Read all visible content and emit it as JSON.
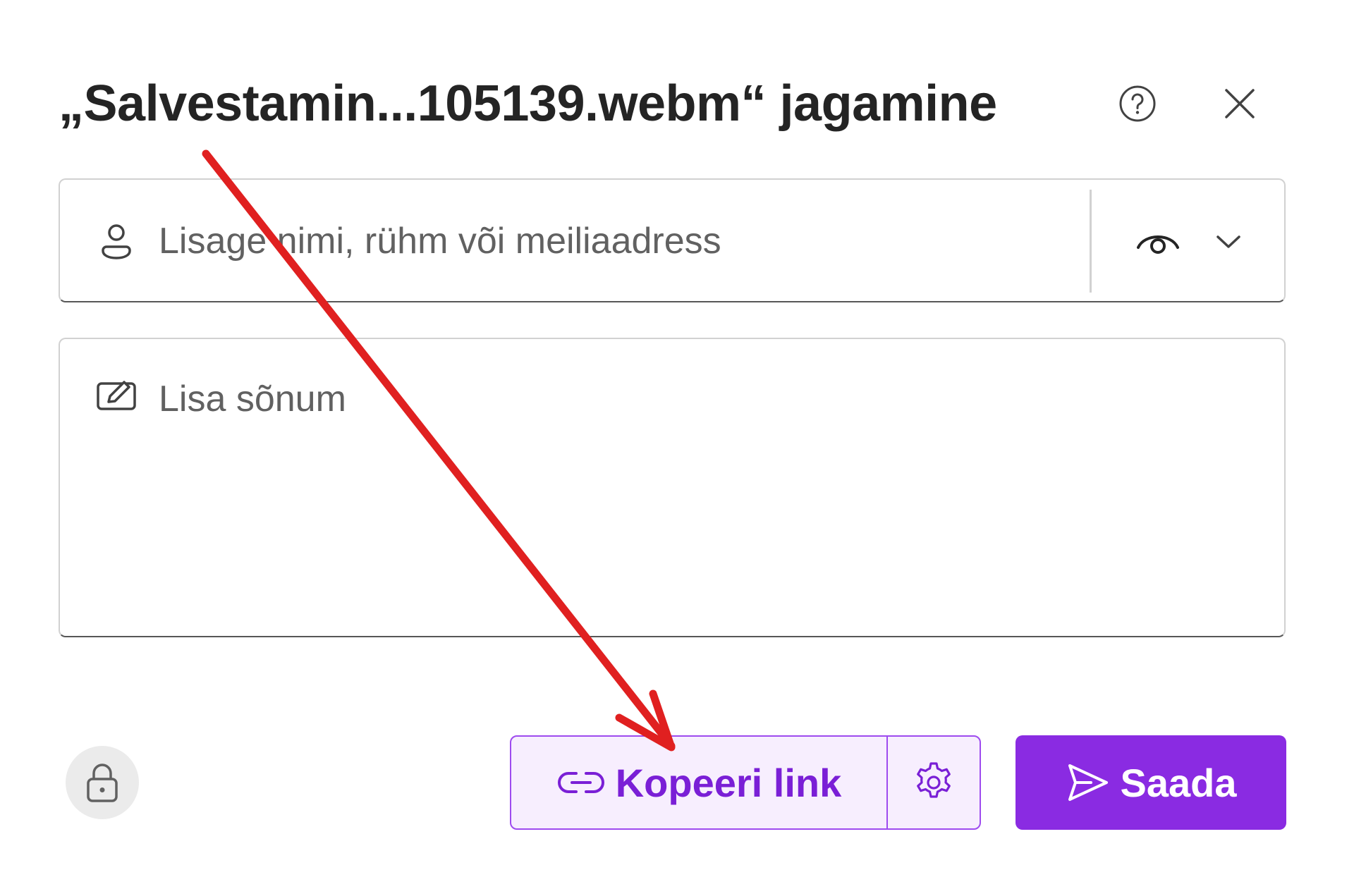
{
  "dialog": {
    "title": "„Salvestamin...105139.webm“ jagamine",
    "help_icon": "question-circle-icon",
    "close_icon": "close-icon"
  },
  "people_input": {
    "icon": "person-icon",
    "placeholder": "Lisage nimi, rühm või meiliaadress",
    "permission_icon": "eye-icon",
    "dropdown_icon": "chevron-down-icon"
  },
  "message_input": {
    "icon": "edit-icon",
    "placeholder": "Lisa sõnum"
  },
  "footer": {
    "lock_icon": "lock-icon",
    "copy_link_label": "Kopeeri link",
    "copy_link_icon": "link-icon",
    "settings_icon": "gear-icon",
    "send_label": "Saada",
    "send_icon": "send-icon"
  },
  "colors": {
    "accent": "#8a2be2",
    "accent_text": "#7a1fd6",
    "copy_bg": "#f7eefe",
    "annotation_arrow": "#e02020"
  }
}
